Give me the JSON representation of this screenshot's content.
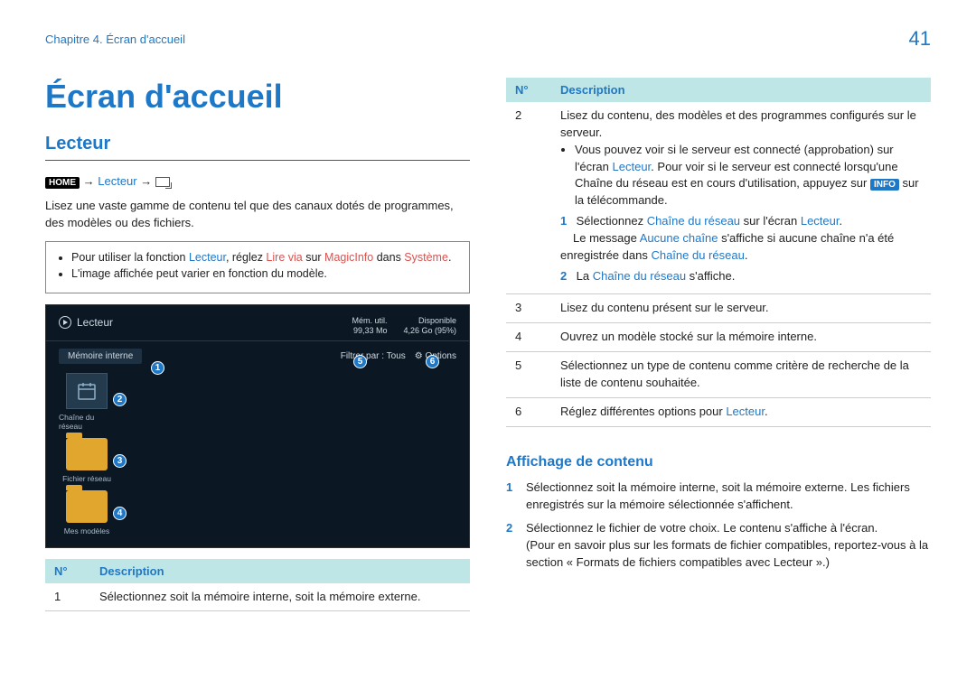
{
  "header": {
    "chapter": "Chapitre 4. Écran d'accueil",
    "page": "41"
  },
  "title": "Écran d'accueil",
  "section": "Lecteur",
  "nav": {
    "home": "HOME",
    "arrow": "→",
    "lecteur": "Lecteur"
  },
  "intro": "Lisez une vaste gamme de contenu tel que des canaux dotés de programmes, des modèles ou des fichiers.",
  "notes": {
    "n1_a": "Pour utiliser la fonction ",
    "n1_b": "Lecteur",
    "n1_c": ", réglez ",
    "n1_d": "Lire via",
    "n1_e": " sur ",
    "n1_f": "MagicInfo",
    "n1_g": " dans ",
    "n1_h": "Système",
    "n1_i": ".",
    "n2": "L'image affichée peut varier en fonction du modèle."
  },
  "device": {
    "title": "Lecteur",
    "mem_label": "Mémoire interne",
    "stats1a": "Mém. util.",
    "stats1b": "99,33 Mo",
    "stats2a": "Disponible",
    "stats2b": "4,26 Go (95%)",
    "filter": "Filtrer par : Tous",
    "options": "Options",
    "item1": "Chaîne du réseau",
    "item2": "Fichier réseau",
    "item3": "Mes modèles"
  },
  "callouts": {
    "c1": "1",
    "c2": "2",
    "c3": "3",
    "c4": "4",
    "c5": "5",
    "c6": "6"
  },
  "table_head": {
    "no": "N°",
    "desc": "Description"
  },
  "table_left": {
    "r1_no": "1",
    "r1_desc": "Sélectionnez soit la mémoire interne, soit la mémoire externe."
  },
  "table_right": {
    "r2_no": "2",
    "r2_line1": "Lisez du contenu, des modèles et des programmes configurés sur le serveur.",
    "r2_b1_a": "Vous pouvez voir si le serveur est connecté (approbation) sur l'écran ",
    "r2_b1_b": "Lecteur",
    "r2_b1_c": ". Pour voir si le serveur est connecté lorsqu'une Chaîne du réseau est en cours d'utilisation, appuyez sur ",
    "r2_b1_info": "INFO",
    "r2_b1_d": " sur la télécommande.",
    "r2_s1_num": "1",
    "r2_s1_a": "Sélectionnez ",
    "r2_s1_b": "Chaîne du réseau",
    "r2_s1_c": " sur l'écran ",
    "r2_s1_d": "Lecteur",
    "r2_s1_e": ".",
    "r2_s1_f": "Le message ",
    "r2_s1_g": "Aucune chaîne",
    "r2_s1_h": " s'affiche si aucune chaîne n'a été enregistrée dans ",
    "r2_s1_i": "Chaîne du réseau",
    "r2_s1_j": ".",
    "r2_s2_num": "2",
    "r2_s2_a": "La ",
    "r2_s2_b": "Chaîne du réseau",
    "r2_s2_c": " s'affiche.",
    "r3_no": "3",
    "r3_desc": "Lisez du contenu présent sur le serveur.",
    "r4_no": "4",
    "r4_desc": "Ouvrez un modèle stocké sur la mémoire interne.",
    "r5_no": "5",
    "r5_desc": "Sélectionnez un type de contenu comme critère de recherche de la liste de contenu souhaitée.",
    "r6_no": "6",
    "r6_a": "Réglez différentes options pour ",
    "r6_b": "Lecteur",
    "r6_c": "."
  },
  "subsection": "Affichage de contenu",
  "content_list": {
    "i1_num": "1",
    "i1": "Sélectionnez soit la mémoire interne, soit la mémoire externe. Les fichiers enregistrés sur la mémoire sélectionnée s'affichent.",
    "i2_num": "2",
    "i2": "Sélectionnez le fichier de votre choix. Le contenu s'affiche à l'écran.",
    "i2b": "(Pour en savoir plus sur les formats de fichier compatibles, reportez-vous à la section « Formats de fichiers compatibles avec Lecteur ».)"
  }
}
